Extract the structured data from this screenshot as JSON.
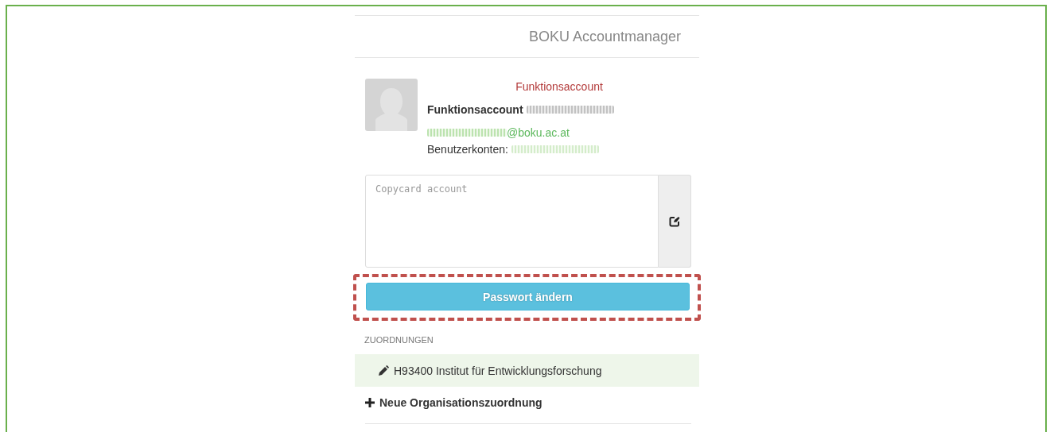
{
  "header": {
    "title": "BOKU Accountmanager"
  },
  "profile": {
    "type_label": "Funktionsaccount",
    "name": "Funktionsaccount",
    "name_redacted": true,
    "email": "@boku.ac.at",
    "email_redacted": true,
    "accounts_label": "Benutzerkonten:",
    "accounts_redacted": true
  },
  "note": {
    "placeholder": "Copycard account"
  },
  "password_button": {
    "label": "Passwort ändern",
    "highlighted": true
  },
  "assignments": {
    "heading": "ZUORDNUNGEN",
    "items": [
      {
        "kind": "edit",
        "label": "H93400 Institut für Entwicklungsforschung"
      },
      {
        "kind": "add",
        "label": "Neue Organisationszuordnung"
      }
    ]
  }
}
